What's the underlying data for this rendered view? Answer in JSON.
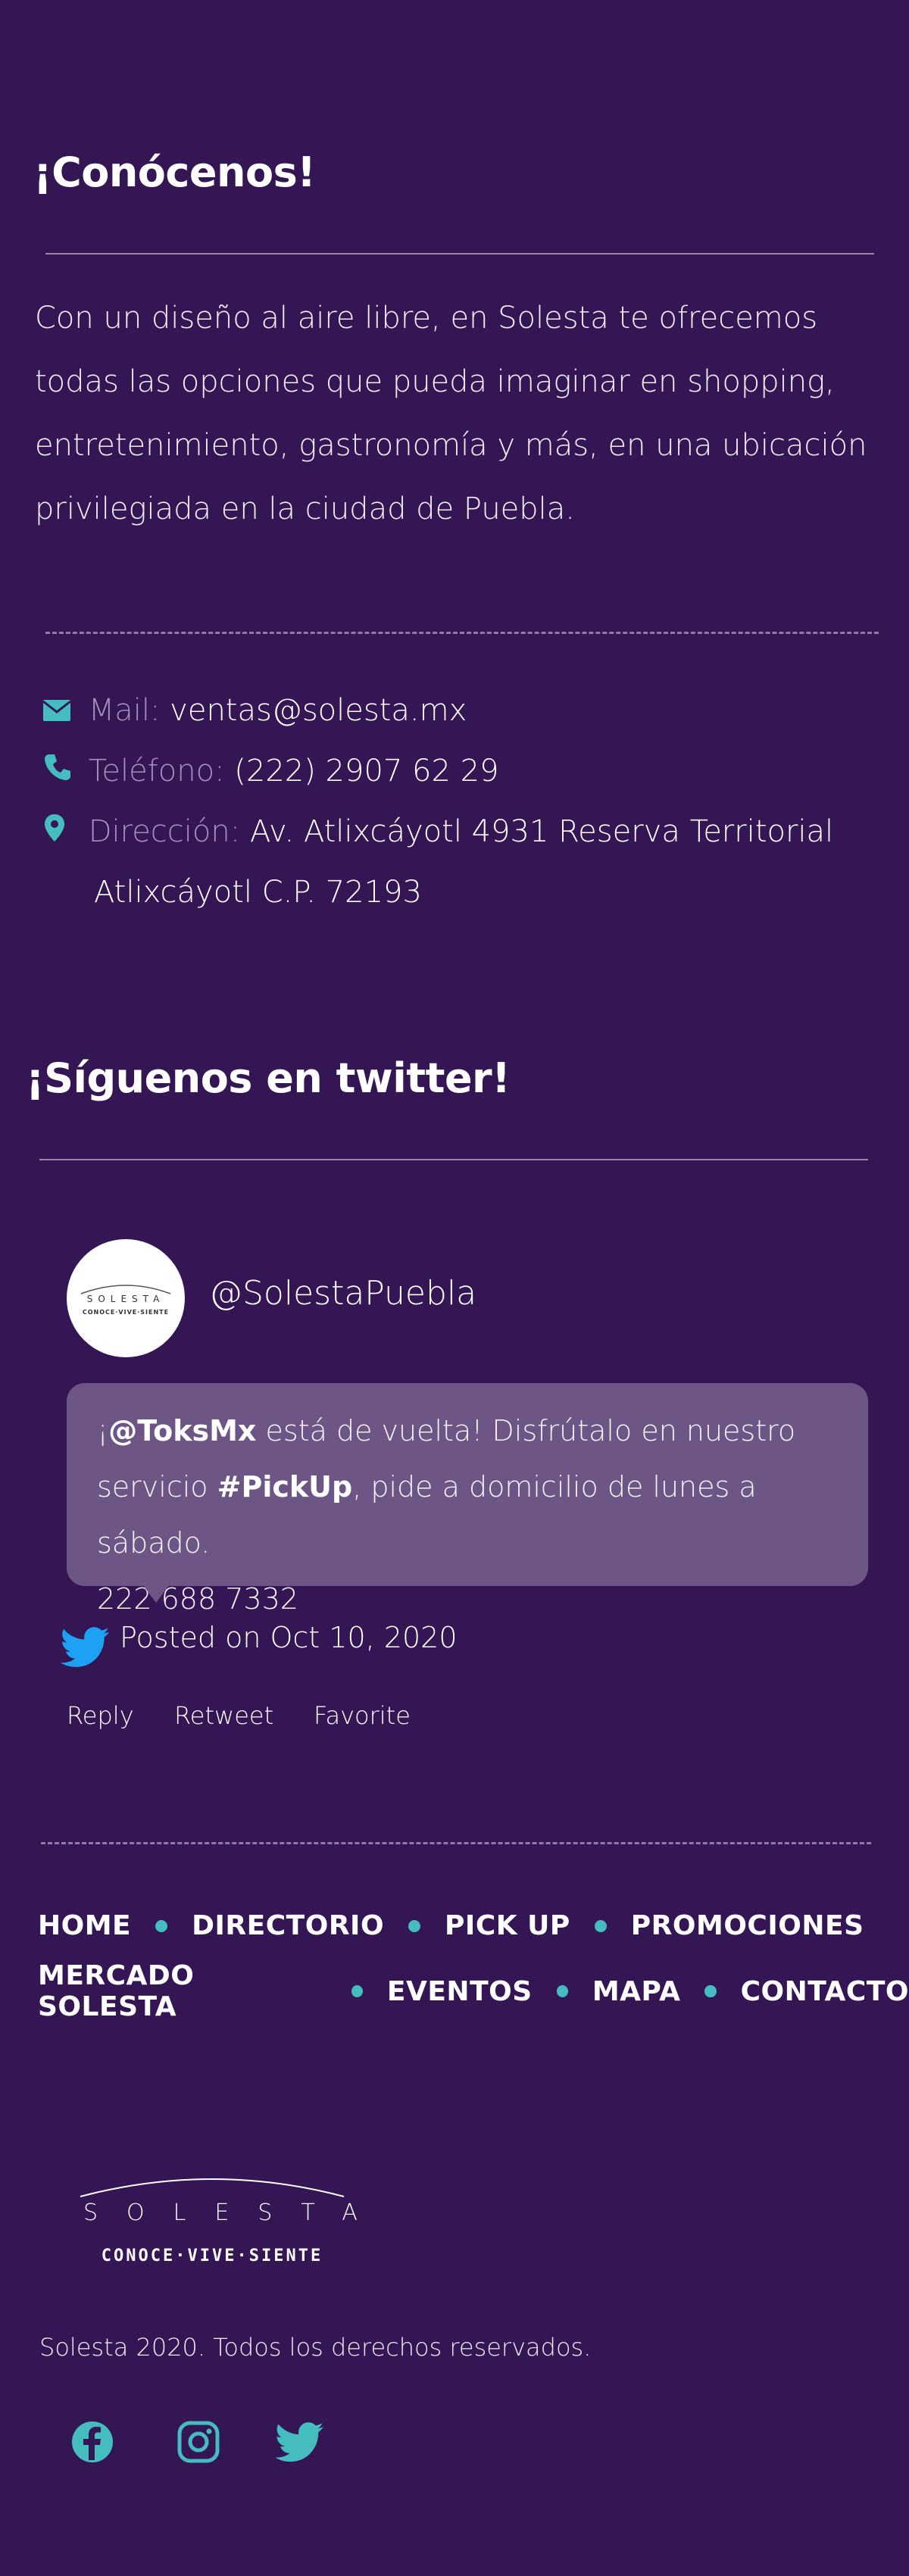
{
  "colors": {
    "background": "#341655",
    "accent": "#45bcc0",
    "bubble": "#6d5685",
    "twitter_blue": "#1da1f2",
    "label_muted": "#a38fbc"
  },
  "about": {
    "title": "¡Conócenos!",
    "text": "Con un diseño al aire libre, en Solesta te ofrecemos todas las opciones que pueda imaginar en shopping, entretenimiento, gastronomía y más, en una ubicación privilegiada en la ciudad de Puebla."
  },
  "contact": {
    "mail": {
      "icon": "mail-icon",
      "label": "Mail:",
      "value": "ventas@solesta.mx"
    },
    "phone": {
      "icon": "phone-icon",
      "label": "Teléfono:",
      "value": "(222) 2907 62 29"
    },
    "address": {
      "icon": "map-pin-icon",
      "label": "Dirección:",
      "value": "Av. Atlixcáyotl 4931 Reserva Territorial",
      "value_line2": "Atlixcáyotl C.P. 72193"
    }
  },
  "twitter": {
    "title": "¡Síguenos en twitter!",
    "handle": "@SolestaPuebla",
    "avatar_logo": {
      "word": "SOLESTA",
      "tagline": "CONOCE·VIVE·SIENTE"
    },
    "tweet": {
      "prefix": "¡",
      "mention": "@ToksMx",
      "text_1": " está de vuelta! Disfrútalo en nuestro servicio ",
      "hashtag": "#PickUp",
      "text_2": ", pide a domicilio de lunes a sábado.",
      "phone_glyph": "",
      "phone": " 222 688 7332"
    },
    "posted": "Posted on Oct 10, 2020",
    "actions": {
      "reply": "Reply",
      "retweet": "Retweet",
      "favorite": "Favorite"
    }
  },
  "footer_nav": {
    "row1": [
      "HOME",
      "DIRECTORIO",
      "PICK UP",
      "PROMOCIONES"
    ],
    "row2": [
      "MERCADO SOLESTA",
      "EVENTOS",
      "MAPA",
      "CONTACTO"
    ]
  },
  "footer": {
    "logo": {
      "word": "SOLESTA",
      "tagline": "CONOCE·VIVE·SIENTE"
    },
    "copyright": "Solesta 2020. Todos los derechos reservados.",
    "social": [
      "facebook-icon",
      "instagram-icon",
      "twitter-icon"
    ]
  }
}
